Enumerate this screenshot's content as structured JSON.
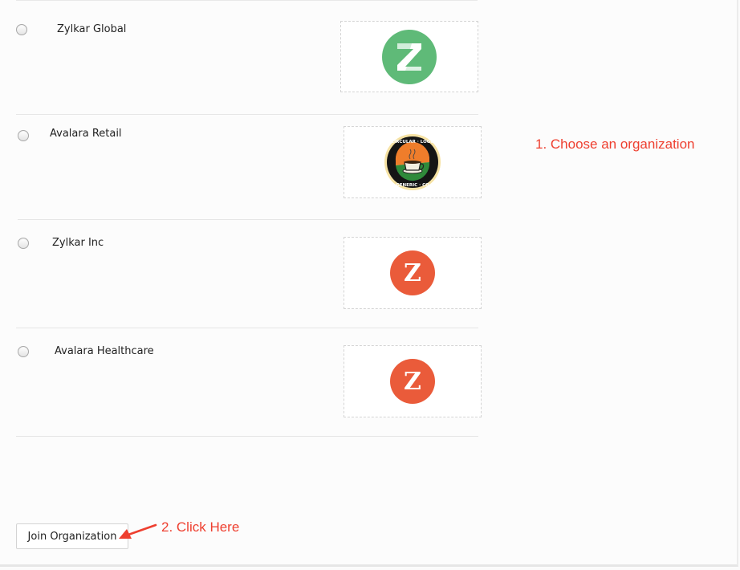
{
  "organizations": [
    {
      "name": "Zylkar Global",
      "selected": false,
      "logo": {
        "type": "z-circle",
        "color": "#5fba78",
        "letter": "Z"
      }
    },
    {
      "name": "Avalara Retail",
      "selected": false,
      "logo": {
        "type": "coffee-badge",
        "ring_text": "GENERIC · CIRCULAR · LOGO · COFFEE · CO"
      }
    },
    {
      "name": "Zylkar Inc",
      "selected": false,
      "logo": {
        "type": "z-circle",
        "color": "#ea5b3a",
        "letter": "Z"
      }
    },
    {
      "name": "Avalara Healthcare",
      "selected": false,
      "logo": {
        "type": "z-circle",
        "color": "#ea5b3a",
        "letter": "Z"
      }
    }
  ],
  "annotations": {
    "step1": "1. Choose an organization",
    "step2": "2. Click Here",
    "color": "#ee3f2f"
  },
  "actions": {
    "join_label": "Join Organization"
  }
}
